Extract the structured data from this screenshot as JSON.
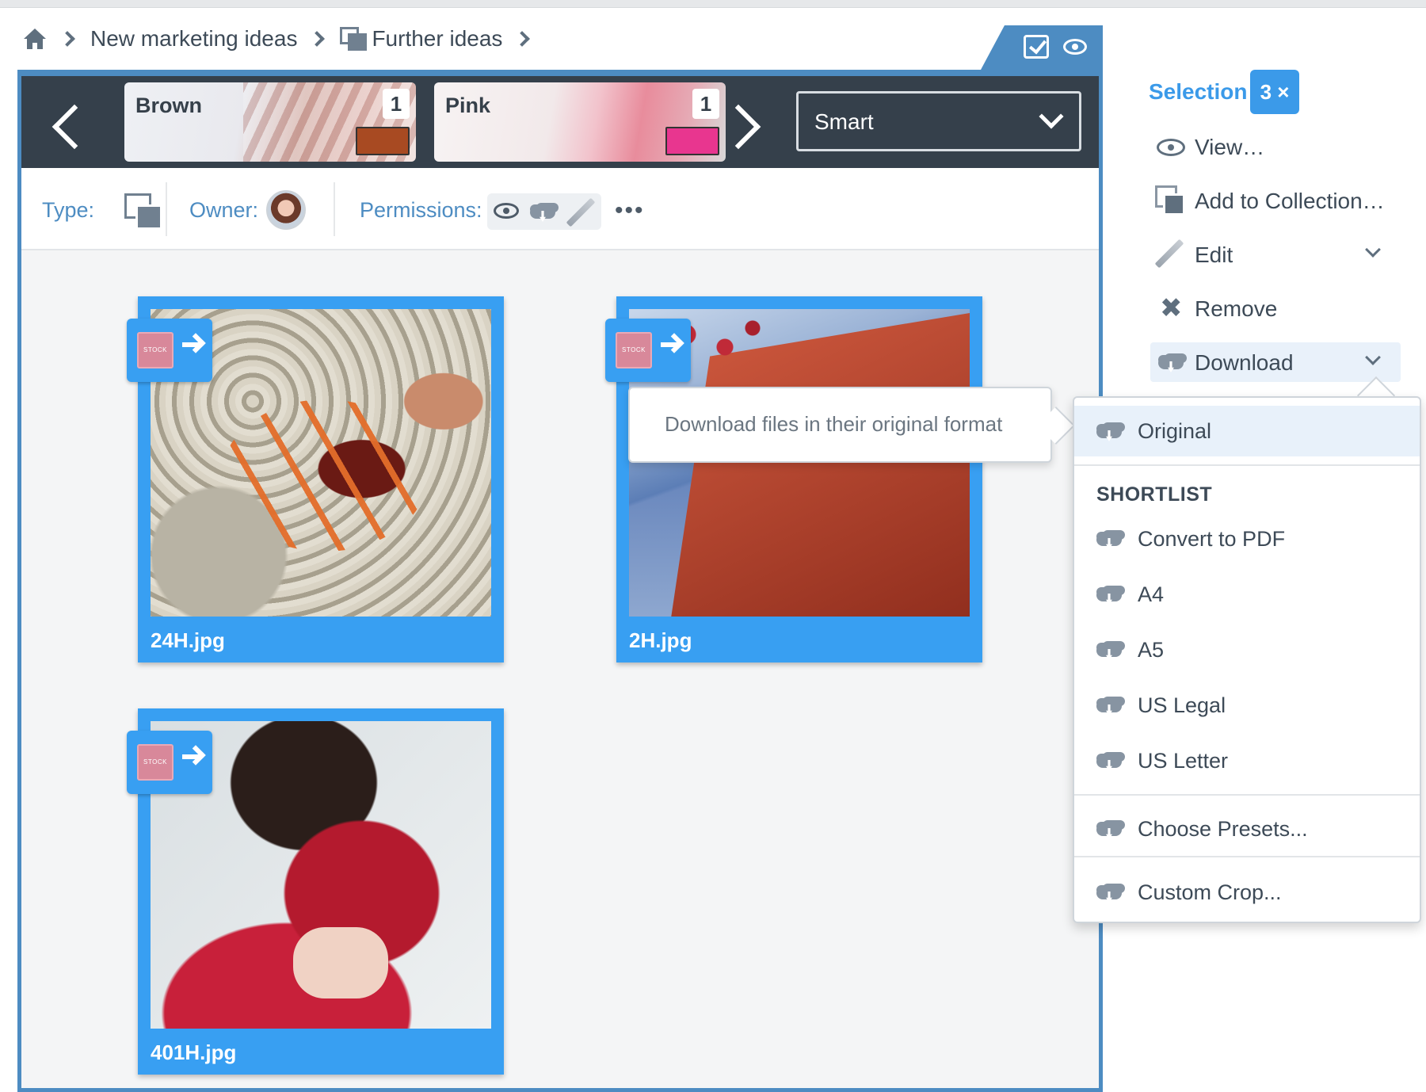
{
  "breadcrumb": {
    "items": [
      "New marketing ideas",
      "Further ideas"
    ]
  },
  "filter_strip": {
    "swatches": [
      {
        "name": "Brown",
        "count": "1",
        "color": "#a84a22"
      },
      {
        "name": "Pink",
        "count": "1",
        "color": "#e8368f"
      }
    ],
    "sort_select": {
      "value": "Smart"
    }
  },
  "info_bar": {
    "type_label": "Type:",
    "owner_label": "Owner:",
    "permissions_label": "Permissions:",
    "more": "•••"
  },
  "assets": [
    {
      "filename": "24H.jpg",
      "badge": "STOCK"
    },
    {
      "filename": "2H.jpg",
      "badge": "STOCK"
    },
    {
      "filename": "401H.jpg",
      "badge": "STOCK"
    }
  ],
  "tooltip": {
    "text": "Download files in their original format"
  },
  "selection": {
    "title": "Selection",
    "count": "3 ×",
    "actions": [
      {
        "label": "View…"
      },
      {
        "label": "Add to Collection…"
      },
      {
        "label": "Edit"
      },
      {
        "label": "Remove"
      },
      {
        "label": "Download"
      }
    ]
  },
  "download_menu": {
    "original": "Original",
    "shortlist_heading": "SHORTLIST",
    "shortlist": [
      "Convert to PDF",
      "A4",
      "A5",
      "US Legal",
      "US Letter"
    ],
    "choose_presets": "Choose Presets...",
    "custom_crop": "Custom Crop..."
  },
  "colors": {
    "accent": "#389ff2",
    "panel_border": "#4d8cc2",
    "dark_strip": "#35404b"
  }
}
